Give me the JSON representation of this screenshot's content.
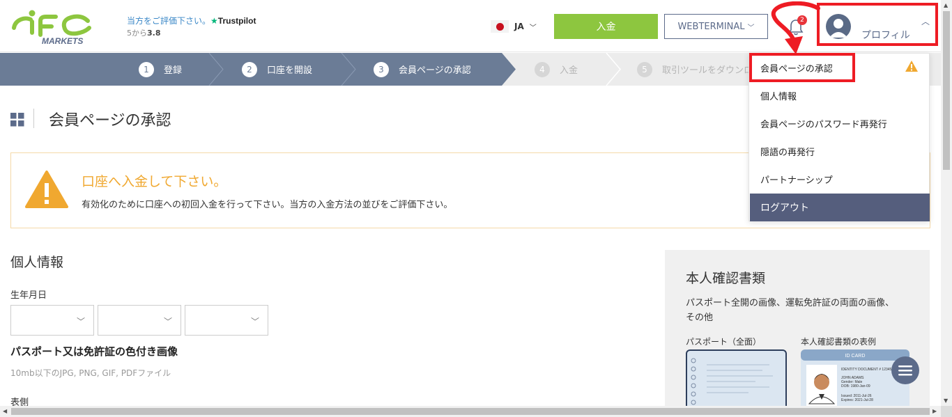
{
  "logo": {
    "brand": "IFC",
    "sub": "MARKETS"
  },
  "trustpilot": {
    "prompt": "当方をご評価下さい。",
    "brand": "Trustpilot",
    "rating_prefix": "5から",
    "rating_value": "3.8"
  },
  "lang": {
    "code": "JA"
  },
  "header": {
    "deposit_label": "入金",
    "webterminal_label": "WEBTERMINAL",
    "notifications_count": "2",
    "profile_label": "プロフィル"
  },
  "steps": [
    {
      "num": "1",
      "label": "登録",
      "state": "done"
    },
    {
      "num": "2",
      "label": "口座を開設",
      "state": "done"
    },
    {
      "num": "3",
      "label": "会員ページの承認",
      "state": "done"
    },
    {
      "num": "4",
      "label": "入金",
      "state": "todo"
    },
    {
      "num": "5",
      "label": "取引ツールをダウンロード",
      "state": "todo"
    }
  ],
  "page": {
    "title": "会員ページの承認"
  },
  "alert": {
    "title": "口座へ入金して下さい。",
    "text": "有効化のために口座への初回入金を行って下さい。当方の入金方法の並びをご評価下さい。"
  },
  "personal": {
    "title": "個人情報",
    "dob_label": "生年月日",
    "passport_title": "パスポート又は免許証の色付き画像",
    "passport_note": "10mb以下のJPG, PNG, GIF, PDFファイル",
    "front_label": "表側"
  },
  "docs_panel": {
    "title": "本人確認書類",
    "desc": "パスポート全開の画像、運転免許証の両面の画像、その他",
    "passport_caption": "パスポート（全面）",
    "idcard_caption": "本人確認書類の表例",
    "idcard_header": "ID CARD",
    "idcard_lines": [
      "IDENTITY DOCUMENT # 12345",
      "JOHN ADAMS",
      "Gender: Male",
      "DOB: 1980-Jan-09",
      "Issued: 2011-Jul-26",
      "Expires: 2021-Jul-28"
    ]
  },
  "dropdown": {
    "items": [
      "会員ページの承認",
      "個人情報",
      "会員ページのパスワード再発行",
      "隠語の再発行",
      "パートナーシップ"
    ],
    "logout": "ログアウト"
  },
  "colors": {
    "green": "#8dc63f",
    "steps_done": "#6b7c96",
    "highlight_red": "#ee1c24",
    "alert_orange": "#f0a830",
    "logout_bg": "#555e7d"
  }
}
